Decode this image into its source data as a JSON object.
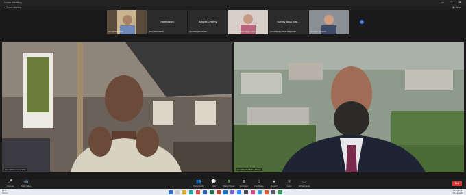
{
  "window": {
    "title": "Zoom Meeting"
  },
  "viewbar": {
    "meeting_label": "● Zoom Meeting",
    "view_label": "▦ View"
  },
  "strip": {
    "tiles": [
      {
        "name": "(icon)Meenakshi",
        "big": ""
      },
      {
        "name": "(icon)Meenakshi",
        "big": "meenakshi"
      },
      {
        "name": "(icon)Angela Grace",
        "big": "Angela Greeny"
      },
      {
        "name": "(icon)Dr. Sakshi Singh, Monday",
        "big": ""
      },
      {
        "name": "(icon)Sanjay Bikal Majumdar",
        "big": "Sanjay Bikal Maj…"
      },
      {
        "name": "(icon)Dr. Mukesh",
        "big": ""
      }
    ]
  },
  "videos": {
    "left_name": "(icon)Mohammad Irfan",
    "right_name": "(icon)Rashid Ahmad Khan"
  },
  "toolbar": {
    "items": [
      {
        "icon": "🎤",
        "label": "Unmute"
      },
      {
        "icon": "📹",
        "label": "Start Video"
      },
      {
        "icon": "👥",
        "label": "Participants"
      },
      {
        "icon": "💬",
        "label": "Chat"
      },
      {
        "icon": "⬆",
        "label": "Share Screen"
      },
      {
        "icon": "⊞",
        "label": "Summary"
      },
      {
        "icon": "☺",
        "label": "Reactions"
      },
      {
        "icon": "⏺",
        "label": "Record"
      },
      {
        "icon": "✳",
        "label": "Apps"
      },
      {
        "icon": "▭",
        "label": "Whiteboards"
      }
    ],
    "end_label": "End"
  },
  "taskbar": {
    "weather_temp": "83°F",
    "weather_desc": "Sunny",
    "lang": "ENG",
    "time": "11:51",
    "date": "14-12-2024"
  },
  "colors": {
    "accent": "#3a74d8",
    "end": "#dd3333"
  }
}
